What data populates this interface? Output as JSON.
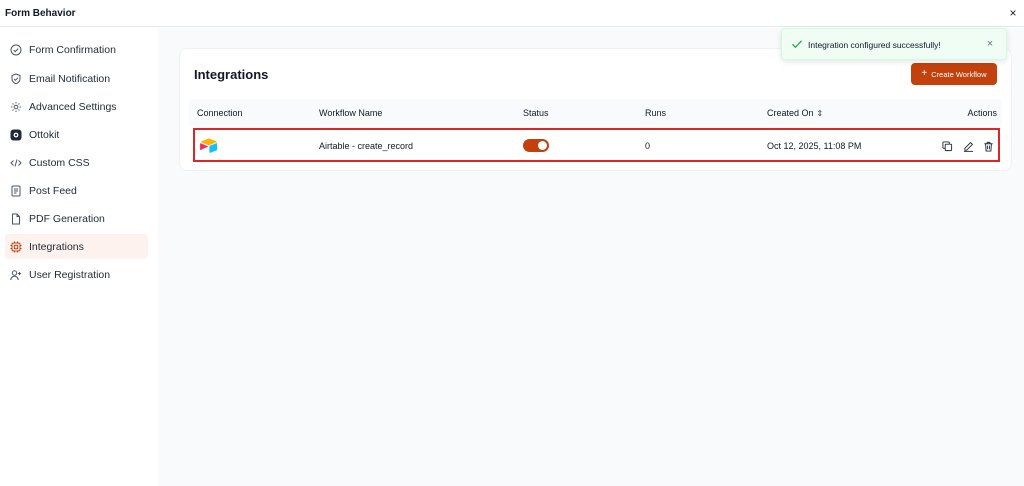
{
  "header": {
    "title": "Form Behavior",
    "close_glyph": "×"
  },
  "sidebar": {
    "active_color": "#c2410c",
    "items": [
      {
        "label": "Form Confirmation",
        "icon": "check-circle-icon"
      },
      {
        "label": "Email Notification",
        "icon": "shield-icon"
      },
      {
        "label": "Advanced Settings",
        "icon": "gear-icon"
      },
      {
        "label": "Ottokit",
        "icon": "ottokit-icon"
      },
      {
        "label": "Custom CSS",
        "icon": "code-icon"
      },
      {
        "label": "Post Feed",
        "icon": "document-icon"
      },
      {
        "label": "PDF Generation",
        "icon": "file-icon"
      },
      {
        "label": "Integrations",
        "icon": "integrations-icon",
        "active": true
      },
      {
        "label": "User Registration",
        "icon": "user-plus-icon"
      }
    ]
  },
  "main": {
    "title": "Integrations",
    "create_button": {
      "label": "Create Workflow",
      "icon": "plus-icon",
      "color": "#c2410c"
    },
    "table": {
      "columns": {
        "connection": "Connection",
        "workflow_name": "Workflow Name",
        "status": "Status",
        "runs": "Runs",
        "created_on": "Created On",
        "actions": "Actions"
      },
      "sort_icon": "sort-icon",
      "rows": [
        {
          "connection_icon": "airtable-logo",
          "workflow_name": "Airtable - create_record",
          "status_enabled": true,
          "runs": "0",
          "created_on": "Oct 12, 2025, 11:08 PM",
          "actions": [
            "copy-icon",
            "edit-icon",
            "trash-icon"
          ]
        }
      ],
      "highlight_color": "#dc2626"
    }
  },
  "toast": {
    "message": "Integration configured successfully!",
    "icon": "check-icon",
    "close_glyph": "×",
    "color": "#16a34a"
  }
}
